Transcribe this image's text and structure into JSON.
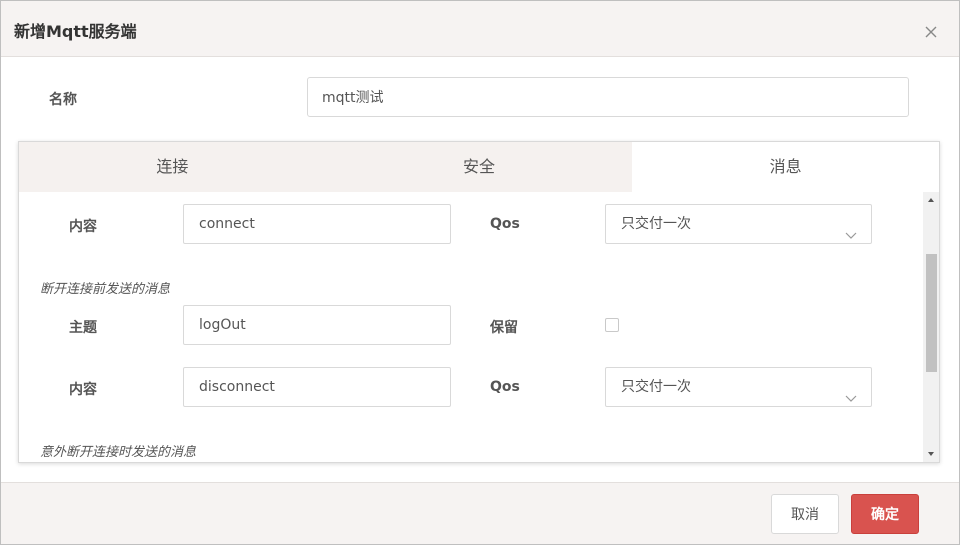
{
  "dialog": {
    "title": "新增Mqtt服务端"
  },
  "form": {
    "name_label": "名称",
    "name_value": "mqtt测试"
  },
  "tabs": [
    {
      "label": "连接",
      "active": false
    },
    {
      "label": "安全",
      "active": false
    },
    {
      "label": "消息",
      "active": true
    }
  ],
  "messages": {
    "content_label": "内容",
    "topic_label": "主题",
    "qos_label": "Qos",
    "retain_label": "保留",
    "connect_content": "connect",
    "connect_qos": "只交付一次",
    "disconnect_section": "断开连接前发送的消息",
    "disconnect_topic": "logOut",
    "disconnect_retain": false,
    "disconnect_content": "disconnect",
    "disconnect_qos": "只交付一次",
    "unexpected_section": "意外断开连接时发送的消息"
  },
  "footer": {
    "cancel_label": "取消",
    "ok_label": "确定"
  },
  "colors": {
    "primary_button": "#d9534f",
    "header_bg": "#f6f3f2",
    "tab_bg": "#f5f1ef"
  }
}
